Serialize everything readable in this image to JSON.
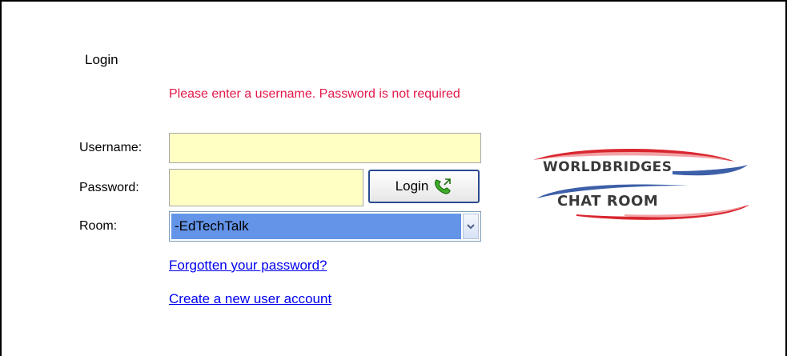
{
  "login": {
    "heading": "Login",
    "notice": "Please enter a username. Password is not required",
    "username_label": "Username:",
    "username_value": "",
    "password_label": "Password:",
    "password_value": "",
    "login_button_label": "Login",
    "room_label": "Room:",
    "room_selected": "-EdTechTalk",
    "forgot_link": "Forgotten your password?",
    "create_link": "Create a new user account"
  },
  "logo": {
    "line1": "WORLDBRIDGES",
    "line2": "CHAT ROOM"
  },
  "colors": {
    "notice": "#e4174a",
    "input_background": "#ffffc4",
    "select_highlight": "#6394e8",
    "link": "#0000ee",
    "logo_red": "#d9262f",
    "logo_blue": "#3d5fa8"
  },
  "icons": {
    "login_button": "phone-icon",
    "select_arrow": "chevron-down-icon"
  }
}
